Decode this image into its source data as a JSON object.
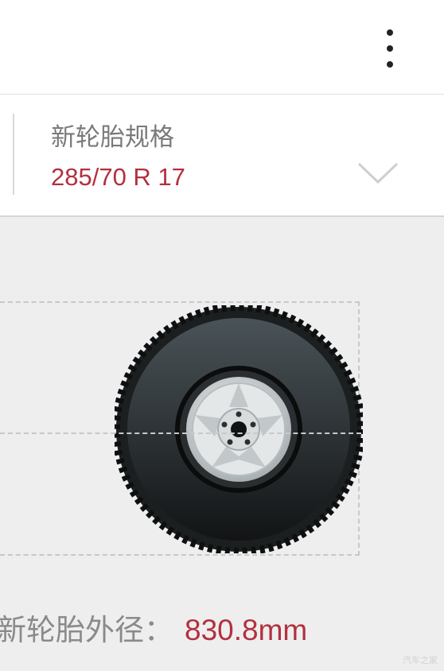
{
  "spec": {
    "label": "新轮胎规格",
    "value": "285/70 R 17"
  },
  "result": {
    "label": "新轮胎外径：",
    "value": "830.8mm"
  },
  "icons": {
    "menu": "more-vert-icon",
    "dropdown": "chevron-down-icon",
    "tire": "tire-illustration"
  },
  "colors": {
    "accent": "#b3303f",
    "background": "#eeeeee"
  },
  "watermark": "汽车之家"
}
